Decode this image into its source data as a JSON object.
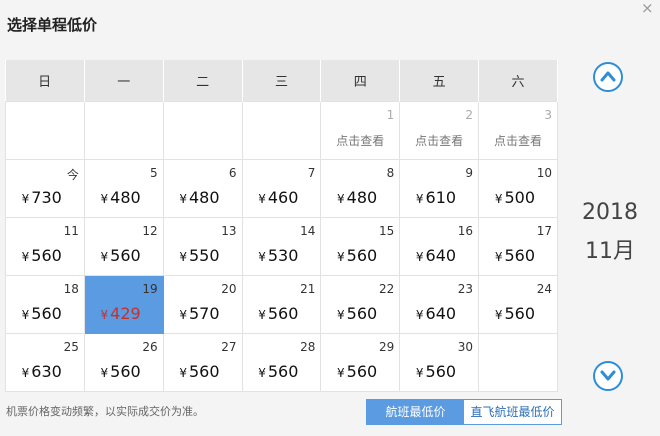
{
  "title": "选择单程低价",
  "close_glyph": "×",
  "weekdays": [
    "日",
    "一",
    "二",
    "三",
    "四",
    "五",
    "六"
  ],
  "currency": "¥",
  "check_label": "点击查看",
  "weeks": [
    [
      {
        "day": ""
      },
      {
        "day": ""
      },
      {
        "day": ""
      },
      {
        "day": ""
      },
      {
        "day": "1",
        "check": true
      },
      {
        "day": "2",
        "check": true
      },
      {
        "day": "3",
        "check": true
      }
    ],
    [
      {
        "day": "今",
        "price": "730"
      },
      {
        "day": "5",
        "price": "480"
      },
      {
        "day": "6",
        "price": "480"
      },
      {
        "day": "7",
        "price": "460"
      },
      {
        "day": "8",
        "price": "480"
      },
      {
        "day": "9",
        "price": "610"
      },
      {
        "day": "10",
        "price": "500"
      }
    ],
    [
      {
        "day": "11",
        "price": "560"
      },
      {
        "day": "12",
        "price": "560"
      },
      {
        "day": "13",
        "price": "550"
      },
      {
        "day": "14",
        "price": "530"
      },
      {
        "day": "15",
        "price": "560"
      },
      {
        "day": "16",
        "price": "640"
      },
      {
        "day": "17",
        "price": "560"
      }
    ],
    [
      {
        "day": "18",
        "price": "560"
      },
      {
        "day": "19",
        "price": "429",
        "selected": true
      },
      {
        "day": "20",
        "price": "570"
      },
      {
        "day": "21",
        "price": "560"
      },
      {
        "day": "22",
        "price": "560"
      },
      {
        "day": "23",
        "price": "640"
      },
      {
        "day": "24",
        "price": "560"
      }
    ],
    [
      {
        "day": "25",
        "price": "630"
      },
      {
        "day": "26",
        "price": "560"
      },
      {
        "day": "27",
        "price": "560"
      },
      {
        "day": "28",
        "price": "560"
      },
      {
        "day": "29",
        "price": "560"
      },
      {
        "day": "30",
        "price": "560"
      },
      {
        "day": ""
      }
    ]
  ],
  "year": "2018",
  "month": "11月",
  "note": "机票价格变动频繁，以实际成交价为准。",
  "toggle": {
    "option1": "航班最低价",
    "option2": "直飞航班最低价"
  },
  "colors": {
    "accent": "#5a9be1",
    "nav": "#2d8ed8",
    "price_selected": "#c9302c"
  },
  "icons": {
    "prev": "chevron-up-icon",
    "next": "chevron-down-icon"
  }
}
